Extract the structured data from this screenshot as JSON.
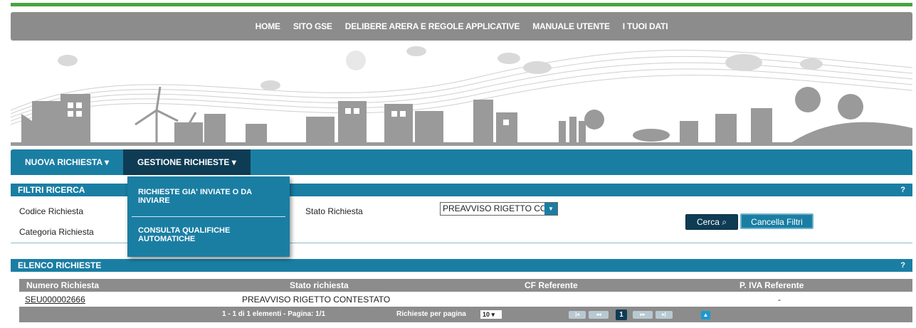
{
  "topnav": [
    "HOME",
    "SITO GSE",
    "DELIBERE ARERA E REGOLE APPLICATIVE",
    "MANUALE UTENTE",
    "I TUOI DATI"
  ],
  "mainnav": {
    "nuova": "NUOVA RICHIESTA ▾",
    "gestione": "GESTIONE RICHIESTE ▾"
  },
  "dropdown": {
    "item1": "RICHIESTE GIA' INVIATE O DA INVIARE",
    "item2": "CONSULTA QUALIFICHE AUTOMATICHE"
  },
  "filtri": {
    "title": "FILTRI RICERCA",
    "help": "?",
    "codice_label": "Codice Richiesta",
    "categoria_label": "Categoria Richiesta",
    "stato_label": "Stato Richiesta",
    "stato_value": "PREAVVISO RIGETTO CONTESTATO",
    "cerca": "Cerca ⌕",
    "cancella": "Cancella Filtri"
  },
  "elenco": {
    "title": "ELENCO RICHIESTE",
    "help": "?",
    "columns": [
      "Numero Richiesta",
      "Stato richiesta",
      "CF Referente",
      "P. IVA Referente"
    ],
    "rows": [
      {
        "numero": "SEU000002666",
        "stato": "PREAVVISO RIGETTO CONTESTATO",
        "cf": "",
        "piva": "-"
      }
    ],
    "pager": {
      "info": "1 - 1 di 1 elementi - Pagina: 1/1",
      "per_page_label": "Richieste per pagina",
      "per_page_value": "10 ▾",
      "first": "|◂",
      "prev": "◂◂",
      "current": "1",
      "next": "▸▸",
      "last": "▸|",
      "top": "▲"
    }
  },
  "colors": {
    "primary": "#1a7ea3",
    "dark": "#0f3c55",
    "gray": "#8c8c8c",
    "green": "#4aa33f"
  }
}
